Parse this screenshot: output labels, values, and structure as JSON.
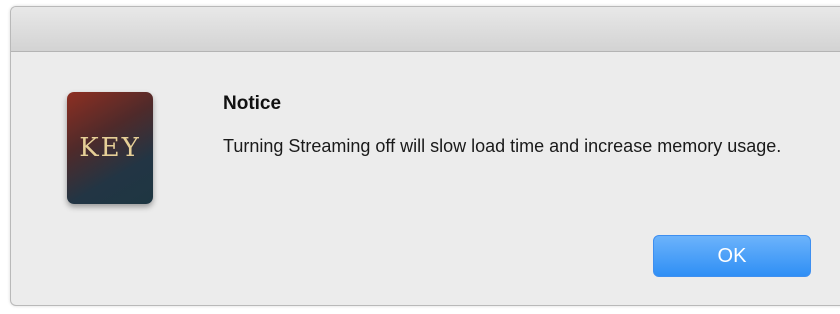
{
  "dialog": {
    "app_icon_text": "KEY",
    "title": "Notice",
    "message": "Turning Streaming off will slow load time and increase memory usage.",
    "ok_label": "OK"
  },
  "colors": {
    "dialog_background": "#ececec",
    "button_blue": "#2f8ff5",
    "icon_gold_text": "#e6cf97"
  }
}
